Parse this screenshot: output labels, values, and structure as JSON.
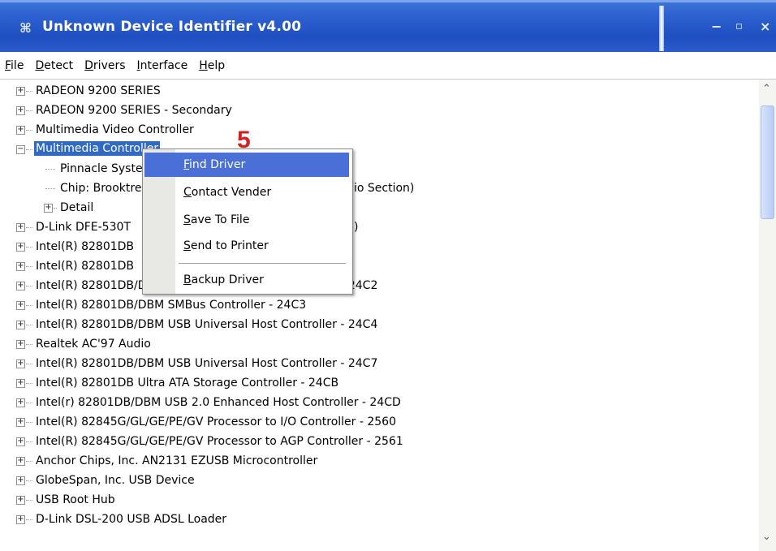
{
  "window": {
    "title": "Unknown Device Identifier v4.00",
    "system_icon": "⌘",
    "minimize": "−",
    "maximize": "▫",
    "close": "×"
  },
  "menu": {
    "items": [
      {
        "label": "File",
        "u": "F",
        "rest": "ile"
      },
      {
        "label": "Detect",
        "u": "D",
        "rest": "etect"
      },
      {
        "label": "Drivers",
        "u": "D",
        "rest": "rivers"
      },
      {
        "label": "Interface",
        "u": "I",
        "rest": "nterface"
      },
      {
        "label": "Help",
        "u": "H",
        "rest": "elp"
      }
    ]
  },
  "tree": {
    "rows": [
      {
        "expander": "+",
        "label": "RADEON 9200 SERIES"
      },
      {
        "expander": "+",
        "label": "RADEON 9200 SERIES - Secondary"
      },
      {
        "expander": "+",
        "label": "Multimedia Video Controller"
      },
      {
        "expander": "−",
        "label": "Multimedia Controller"
      },
      {
        "expander": "",
        "label": "Pinnacle Systems"
      },
      {
        "expander": "",
        "label": "Chip: Brooktree",
        "label_tail": "io Section)"
      },
      {
        "expander": "+",
        "label": "Detail"
      },
      {
        "expander": "+",
        "label": "D-Link DFE-530T",
        "label_tail": ")"
      },
      {
        "expander": "+",
        "label": "Intel(R) 82801DB"
      },
      {
        "expander": "+",
        "label": "Intel(R) 82801DB"
      },
      {
        "expander": "+",
        "label": "Intel(R) 82801DB/DBM USB Universal Host Controller - 24C2"
      },
      {
        "expander": "+",
        "label": "Intel(R) 82801DB/DBM SMBus Controller - 24C3"
      },
      {
        "expander": "+",
        "label": "Intel(R) 82801DB/DBM USB Universal Host Controller - 24C4"
      },
      {
        "expander": "+",
        "label": "Realtek AC'97 Audio"
      },
      {
        "expander": "+",
        "label": "Intel(R) 82801DB/DBM USB Universal Host Controller - 24C7"
      },
      {
        "expander": "+",
        "label": "Intel(R) 82801DB Ultra ATA Storage Controller - 24CB"
      },
      {
        "expander": "+",
        "label": "Intel(r) 82801DB/DBM USB 2.0 Enhanced Host Controller - 24CD"
      },
      {
        "expander": "+",
        "label": "Intel(R) 82845G/GL/GE/PE/GV Processor to I/O Controller - 2560"
      },
      {
        "expander": "+",
        "label": "Intel(R) 82845G/GL/GE/PE/GV Processor to AGP Controller - 2561"
      },
      {
        "expander": "+",
        "label": "Anchor Chips, Inc. AN2131 EZUSB Microcontroller"
      },
      {
        "expander": "+",
        "label": "GlobeSpan, Inc. USB Device"
      },
      {
        "expander": "+",
        "label": "USB Root Hub"
      },
      {
        "expander": "+",
        "label": "D-Link DSL-200 USB ADSL Loader"
      }
    ]
  },
  "context_menu": {
    "items": [
      {
        "label": "Find Driver",
        "u": "F",
        "rest": "ind Driver",
        "highlighted": true
      },
      {
        "label": "Contact Vender",
        "u": "C",
        "rest": "ontact Vender"
      },
      {
        "label": "Save To File",
        "u": "S",
        "rest": "ave To File"
      },
      {
        "label": "Send to Printer",
        "u": "S",
        "rest": "end to Printer"
      },
      {
        "label": "Backup Driver",
        "u": "B",
        "rest": "ackup Driver"
      }
    ]
  },
  "annotation": {
    "step_number": "5"
  },
  "scrollbar": {
    "up_arrow": "⌃",
    "down_arrow": "⌄"
  },
  "colors": {
    "titlebar": "#2c5fcf",
    "selection": "#316ac5",
    "menu_highlight": "#4a6fd6",
    "annotation": "#d62020"
  }
}
